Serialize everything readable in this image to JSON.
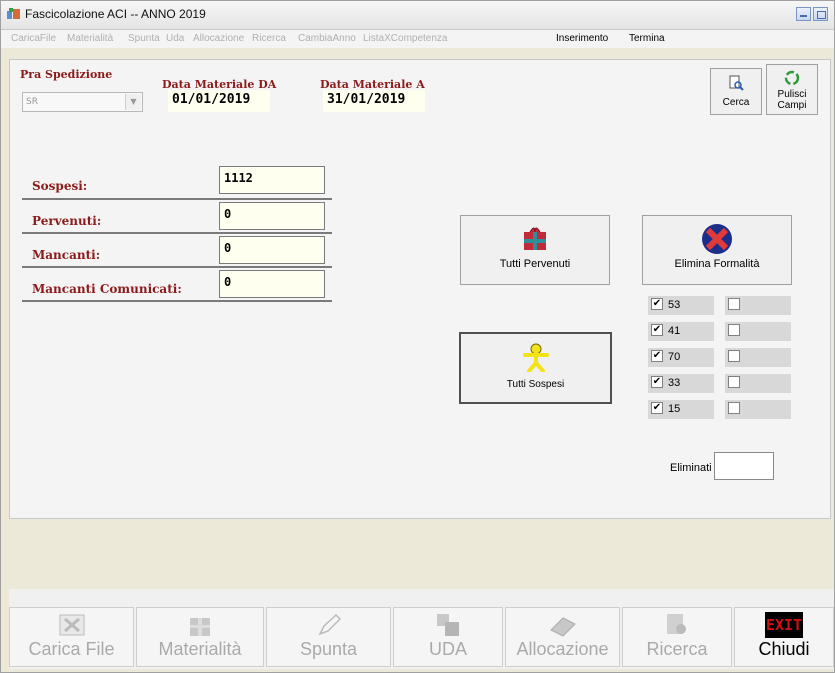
{
  "window": {
    "title": "Fascicolazione ACI -- ANNO 2019"
  },
  "menu": {
    "items": [
      {
        "label": "CaricaFile",
        "enabled": false
      },
      {
        "label": "Materialità",
        "enabled": false
      },
      {
        "label": "Spunta",
        "enabled": false
      },
      {
        "label": "Uda",
        "enabled": false
      },
      {
        "label": "Allocazione",
        "enabled": false
      },
      {
        "label": "Ricerca",
        "enabled": false
      },
      {
        "label": "CambiaAnno",
        "enabled": false
      },
      {
        "label": "ListaXCompetenza",
        "enabled": false
      },
      {
        "label": "Inserimento",
        "enabled": true
      },
      {
        "label": "Termina",
        "enabled": true
      }
    ]
  },
  "filters": {
    "pra_label": "Pra Spedizione",
    "pra_value": "SR",
    "date_from_label": "Data Materiale DA",
    "date_from_value": "01/01/2019",
    "date_to_label": "Data Materiale A",
    "date_to_value": "31/01/2019"
  },
  "toolbar": {
    "cerca_label": "Cerca",
    "pulisci_label_1": "Pulisci",
    "pulisci_label_2": "Campi"
  },
  "fields": [
    {
      "label": "Sospesi:",
      "value": "1112"
    },
    {
      "label": "Pervenuti:",
      "value": "0"
    },
    {
      "label": "Mancanti:",
      "value": "0"
    },
    {
      "label": "Mancanti Comunicati:",
      "value": "0"
    }
  ],
  "actions": {
    "tutti_pervenuti": "Tutti Pervenuti",
    "elimina_formalita": "Elimina Formalità",
    "tutti_sospesi": "Tutti Sospesi"
  },
  "checks": [
    {
      "value": "53",
      "checked": true
    },
    {
      "value": "41",
      "checked": true
    },
    {
      "value": "70",
      "checked": true
    },
    {
      "value": "33",
      "checked": true
    },
    {
      "value": "15",
      "checked": true
    }
  ],
  "eliminati": {
    "label": "Eliminati",
    "value": ""
  },
  "bottom": [
    {
      "label": "Carica File",
      "icon": "file-icon",
      "enabled": false
    },
    {
      "label": "Materialità",
      "icon": "box-icon",
      "enabled": false
    },
    {
      "label": "Spunta",
      "icon": "pen-icon",
      "enabled": false
    },
    {
      "label": "UDA",
      "icon": "uda-icon",
      "enabled": false
    },
    {
      "label": "Allocazione",
      "icon": "eraser-icon",
      "enabled": false
    },
    {
      "label": "Ricerca",
      "icon": "search-doc-icon",
      "enabled": false
    },
    {
      "label": "Chiudi",
      "icon": "exit-icon",
      "enabled": true,
      "icon_text": "EXIT"
    }
  ]
}
